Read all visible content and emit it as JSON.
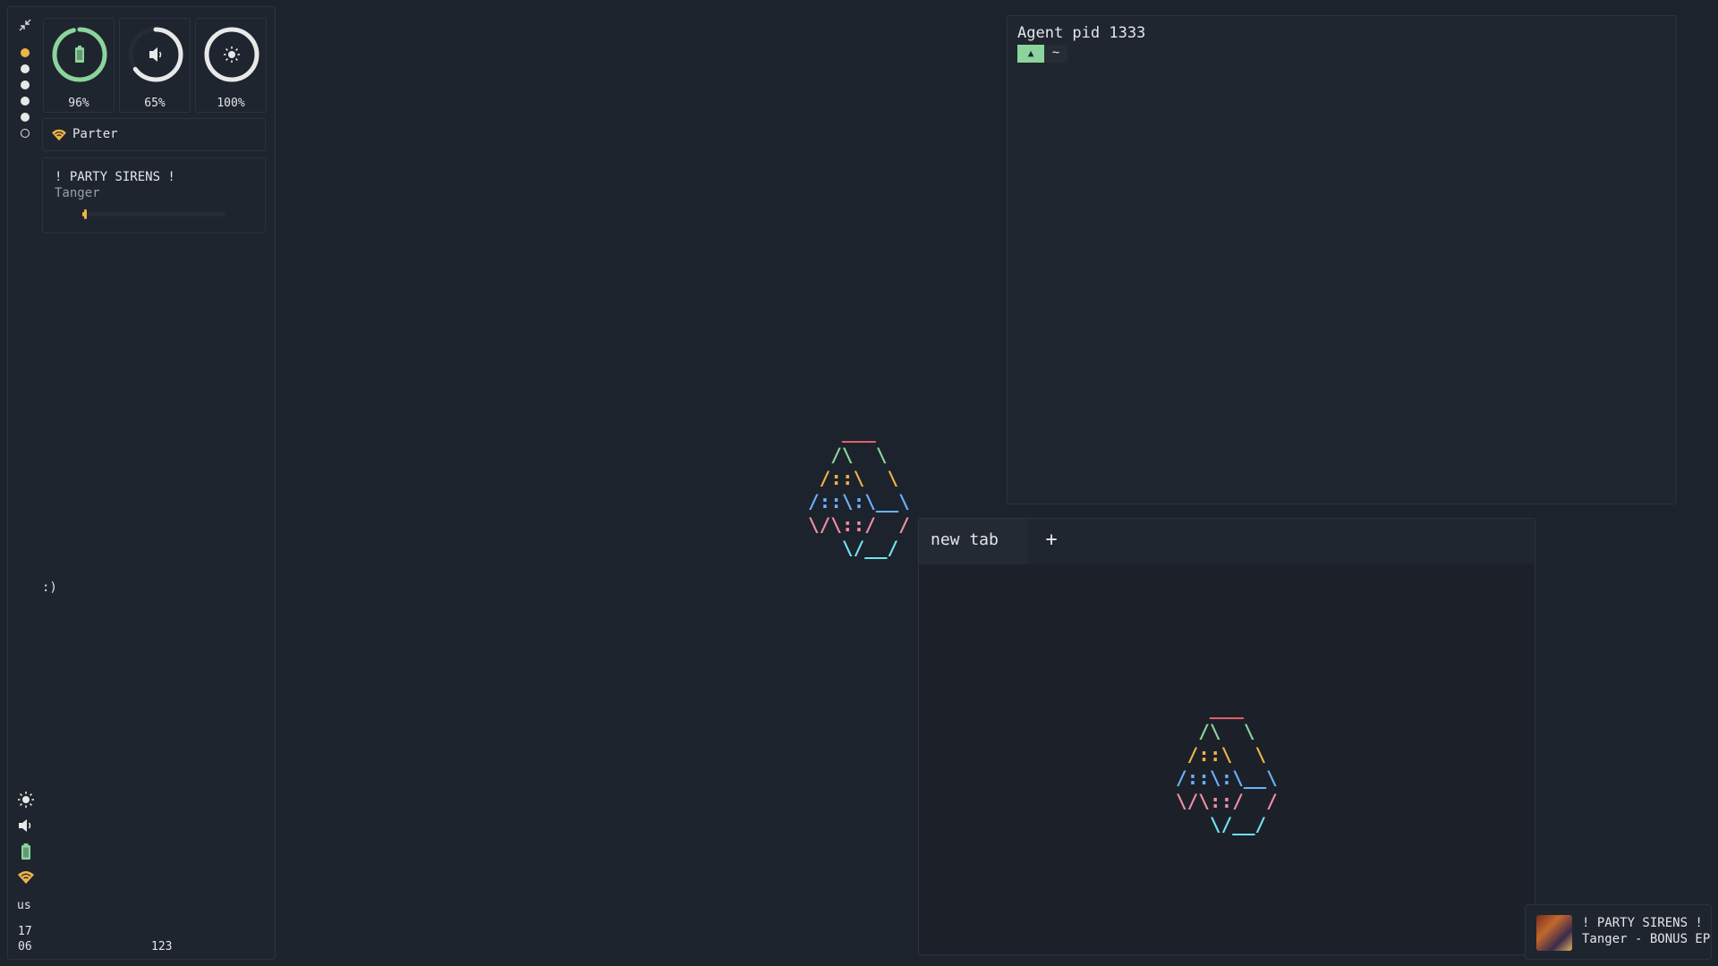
{
  "bar": {
    "collapse_icon": "collapse-arrows-icon",
    "workspaces": [
      {
        "state": "active"
      },
      {
        "state": "occupied"
      },
      {
        "state": "occupied"
      },
      {
        "state": "occupied"
      },
      {
        "state": "occupied"
      },
      {
        "state": "empty"
      }
    ],
    "gauges": [
      {
        "name": "battery",
        "icon": "battery-icon",
        "label": "96%",
        "value": 0.96,
        "color": "#8bd49c"
      },
      {
        "name": "volume",
        "icon": "speaker-icon",
        "label": "65%",
        "value": 0.65,
        "color": "#e8e8e8"
      },
      {
        "name": "brightness",
        "icon": "sun-icon",
        "label": "100%",
        "value": 1.0,
        "color": "#e8e8e8"
      }
    ],
    "network": {
      "icon": "wifi-icon",
      "label": "Parter"
    },
    "media": {
      "title": "! PARTY SIRENS !",
      "artist": "Tanger",
      "progress": 0.02
    },
    "mood": ":)",
    "keyboard_layout": "us",
    "clock": {
      "hour": "17",
      "minute": "06"
    },
    "numlock": "123"
  },
  "terminal": {
    "title": "Agent pid 1333",
    "prompt_icon": "▲",
    "prompt_dir": "~"
  },
  "window2": {
    "tab_label": "new tab",
    "add_tab": "+"
  },
  "logo": {
    "lines": [
      {
        "text": "   ___",
        "color": "#e0606a"
      },
      {
        "text": "  /\\  \\",
        "color": "#8bd49c"
      },
      {
        "text": " /::\\  \\",
        "color": "#f0b347"
      },
      {
        "text": "/::\\:\\__\\",
        "color": "#6cb0ff"
      },
      {
        "text": "\\/\\::/  /",
        "color": "#f08fa4"
      },
      {
        "text": "   \\/__/",
        "color": "#6fe3f0"
      }
    ]
  },
  "notification": {
    "title": "! PARTY SIRENS !",
    "subtitle": "Tanger - BONUS EP"
  },
  "colors": {
    "accent": "#f0b347",
    "battery": "#8bd49c",
    "background": "#1d232c"
  }
}
